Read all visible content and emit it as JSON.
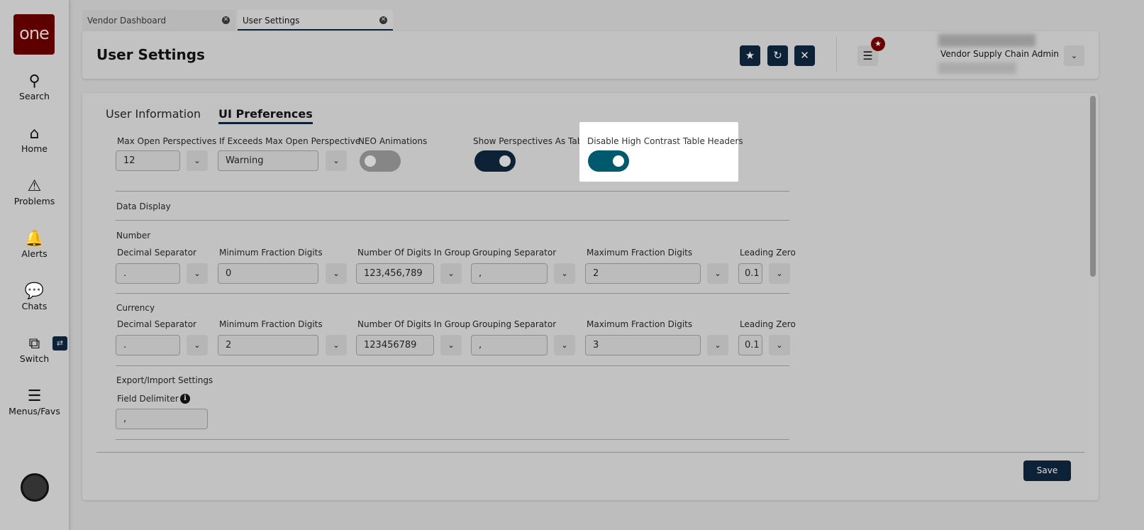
{
  "sidebar": {
    "logo": "one",
    "items": [
      {
        "label": "Search",
        "icon": "search-icon"
      },
      {
        "label": "Home",
        "icon": "home-icon"
      },
      {
        "label": "Problems",
        "icon": "warning-icon"
      },
      {
        "label": "Alerts",
        "icon": "bell-icon"
      },
      {
        "label": "Chats",
        "icon": "chat-icon"
      },
      {
        "label": "Switch",
        "icon": "switch-icon"
      },
      {
        "label": "Menus/Favs",
        "icon": "menu-icon"
      }
    ]
  },
  "tabs": [
    {
      "label": "Vendor Dashboard"
    },
    {
      "label": "User Settings",
      "active": true
    }
  ],
  "header": {
    "title": "User Settings",
    "role": "Vendor Supply Chain Admin"
  },
  "settings_tabs": [
    {
      "label": "User Information"
    },
    {
      "label": "UI Preferences",
      "active": true
    }
  ],
  "prefs": {
    "max_open": {
      "label": "Max Open Perspectives",
      "value": "12"
    },
    "exceeds": {
      "label": "If Exceeds Max Open Perspective",
      "value": "Warning"
    },
    "neo": {
      "label": "NEO Animations",
      "on": false
    },
    "show_tabs": {
      "label": "Show Perspectives As Tabs",
      "on": true
    },
    "high_contrast": {
      "label": "Disable High Contrast Table Headers",
      "on": true
    }
  },
  "data_display": "Data Display",
  "number": {
    "title": "Number",
    "fields": [
      {
        "label": "Decimal Separator",
        "value": "."
      },
      {
        "label": "Minimum Fraction Digits",
        "value": "0"
      },
      {
        "label": "Number Of Digits In Group",
        "value": "123,456,789"
      },
      {
        "label": "Grouping Separator",
        "value": ","
      },
      {
        "label": "Maximum Fraction Digits",
        "value": "2"
      },
      {
        "label": "Leading Zero",
        "value": "0.1"
      }
    ]
  },
  "currency": {
    "title": "Currency",
    "fields": [
      {
        "label": "Decimal Separator",
        "value": "."
      },
      {
        "label": "Minimum Fraction Digits",
        "value": "2"
      },
      {
        "label": "Number Of Digits In Group",
        "value": "123456789"
      },
      {
        "label": "Grouping Separator",
        "value": ","
      },
      {
        "label": "Maximum Fraction Digits",
        "value": "3"
      },
      {
        "label": "Leading Zero",
        "value": "0.1"
      }
    ]
  },
  "export": {
    "title": "Export/Import Settings",
    "field_label": "Field Delimiter",
    "field_value": ","
  },
  "save_label": "Save",
  "colors": {
    "brand": "#5e0000",
    "navy": "#0d2236",
    "teal": "#005a6e"
  }
}
